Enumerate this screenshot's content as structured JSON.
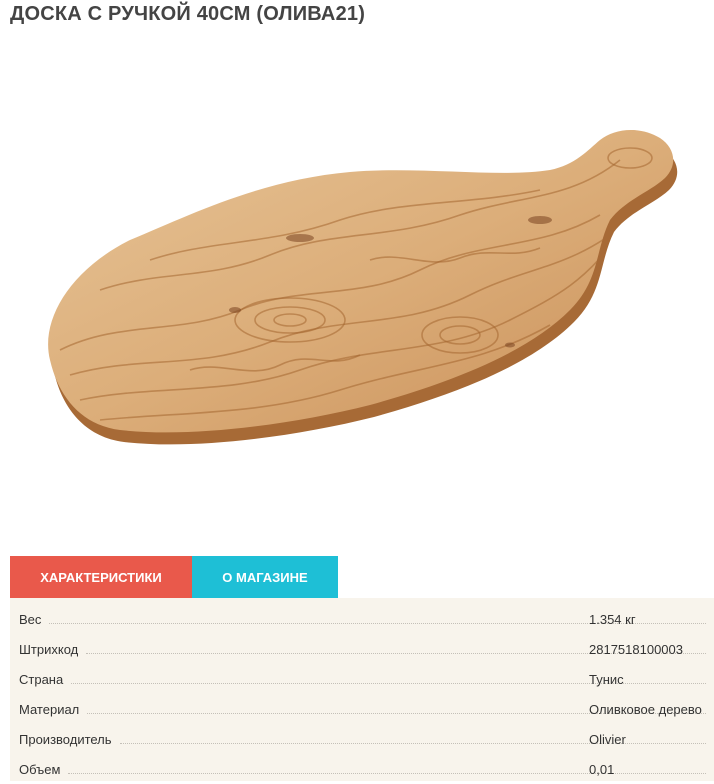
{
  "product": {
    "title": "ДОСКА С РУЧКОЙ 40СМ (ОЛИВА21)"
  },
  "tabs": [
    {
      "label": "ХАРАКТЕРИСТИКИ",
      "color": "#e9594b",
      "active": true
    },
    {
      "label": "О МАГАЗИНЕ",
      "color": "#1ebfd6",
      "active": false
    }
  ],
  "specs": [
    {
      "label": "Вес",
      "value": "1.354 кг"
    },
    {
      "label": "Штрихкод",
      "value": "2817518100003"
    },
    {
      "label": "Страна",
      "value": "Тунис"
    },
    {
      "label": "Материал",
      "value": "Оливковое дерево"
    },
    {
      "label": "Производитель",
      "value": "Olivier"
    },
    {
      "label": "Объем",
      "value": "0,01"
    }
  ],
  "colors": {
    "panel_background": "#f8f4ec",
    "wood_light": "#e8c49a",
    "wood_dark": "#9a5e2e"
  },
  "image": {
    "subject": "olive-wood-board-with-handle"
  }
}
